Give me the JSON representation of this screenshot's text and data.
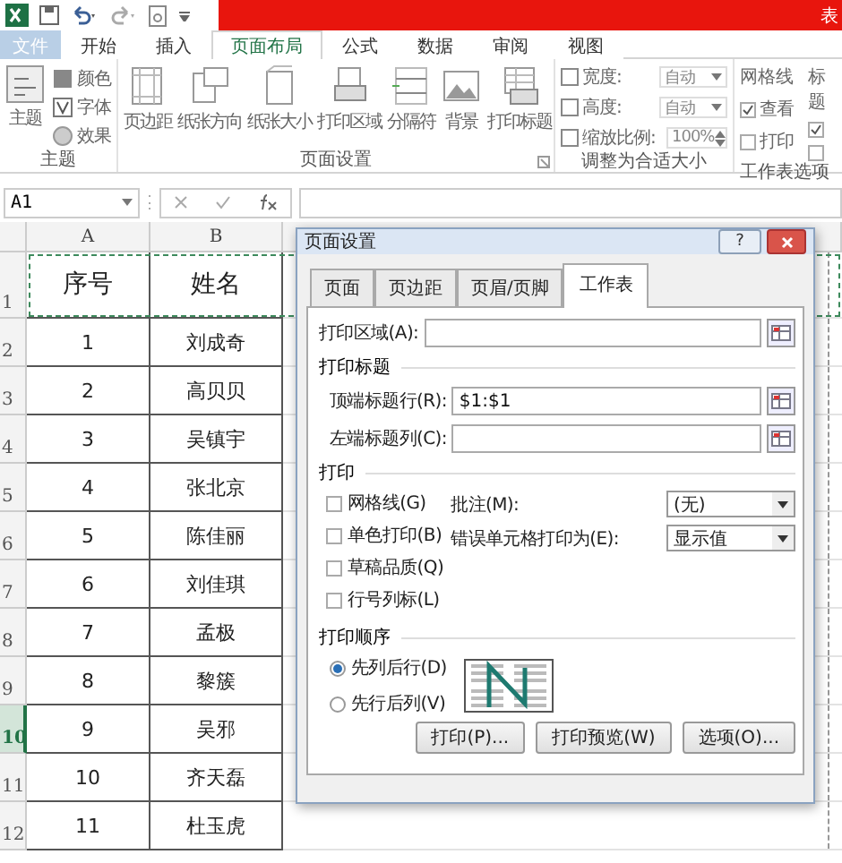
{
  "title_bar": {
    "title": "表"
  },
  "ribbon_tabs": [
    {
      "label": "文件",
      "kind": "file",
      "selected": false
    },
    {
      "label": "开始",
      "kind": "tab",
      "selected": false
    },
    {
      "label": "插入",
      "kind": "tab",
      "selected": false
    },
    {
      "label": "页面布局",
      "kind": "tab",
      "selected": true
    },
    {
      "label": "公式",
      "kind": "tab",
      "selected": false
    },
    {
      "label": "数据",
      "kind": "tab",
      "selected": false
    },
    {
      "label": "审阅",
      "kind": "tab",
      "selected": false
    },
    {
      "label": "视图",
      "kind": "tab",
      "selected": false
    }
  ],
  "ribbon": {
    "theme_group": {
      "label": "主题",
      "big_button": "主题",
      "items": [
        "颜色",
        "字体",
        "效果"
      ]
    },
    "page_setup_group": {
      "label": "页面设置",
      "buttons": [
        "页边距",
        "纸张方向",
        "纸张大小",
        "打印区域",
        "分隔符",
        "背景",
        "打印标题"
      ]
    },
    "scale_group": {
      "label": "调整为合适大小",
      "rows": [
        {
          "label": "宽度:",
          "value": "自动",
          "kind": "dropdown"
        },
        {
          "label": "高度:",
          "value": "自动",
          "kind": "dropdown"
        },
        {
          "label": "缩放比例:",
          "value": "100%",
          "kind": "spinner"
        }
      ]
    },
    "sheet_options_group": {
      "label": "工作表选项",
      "columns": [
        {
          "heading": "网格线",
          "options": [
            {
              "label": "查看",
              "checked": true
            },
            {
              "label": "打印",
              "checked": false
            }
          ]
        },
        {
          "heading": "标题",
          "options": [
            {
              "checked": true
            },
            {
              "checked": false
            }
          ]
        }
      ]
    }
  },
  "formula_bar": {
    "name_box": "A1"
  },
  "sheet": {
    "columns": [
      "A",
      "B"
    ],
    "rows": [
      {
        "number": "1",
        "cells": [
          "序号",
          "姓名"
        ],
        "selected": false,
        "marquee": true
      },
      {
        "number": "2",
        "cells": [
          "1",
          "刘成奇"
        ],
        "selected": false,
        "marquee": false
      },
      {
        "number": "3",
        "cells": [
          "2",
          "高贝贝"
        ],
        "selected": false,
        "marquee": false
      },
      {
        "number": "4",
        "cells": [
          "3",
          "吴镇宇"
        ],
        "selected": false,
        "marquee": false
      },
      {
        "number": "5",
        "cells": [
          "4",
          "张北京"
        ],
        "selected": false,
        "marquee": false
      },
      {
        "number": "6",
        "cells": [
          "5",
          "陈佳丽"
        ],
        "selected": false,
        "marquee": false
      },
      {
        "number": "7",
        "cells": [
          "6",
          "刘佳琪"
        ],
        "selected": false,
        "marquee": false
      },
      {
        "number": "8",
        "cells": [
          "7",
          "孟极"
        ],
        "selected": false,
        "marquee": false
      },
      {
        "number": "9",
        "cells": [
          "8",
          "黎簇"
        ],
        "selected": false,
        "marquee": false
      },
      {
        "number": "10",
        "cells": [
          "9",
          "吴邪"
        ],
        "selected": true,
        "marquee": false
      },
      {
        "number": "11",
        "cells": [
          "10",
          "齐天磊"
        ],
        "selected": false,
        "marquee": false
      },
      {
        "number": "12",
        "cells": [
          "11",
          "杜玉虎"
        ],
        "selected": false,
        "marquee": false
      }
    ]
  },
  "dialog": {
    "title": "页面设置",
    "help": "?",
    "tabs": [
      {
        "label": "页面",
        "selected": false
      },
      {
        "label": "页边距",
        "selected": false
      },
      {
        "label": "页眉/页脚",
        "selected": false
      },
      {
        "label": "工作表",
        "selected": true
      }
    ],
    "print_area": {
      "label": "打印区域(A):"
    },
    "print_titles": {
      "heading": "打印标题",
      "fields": [
        {
          "label": "顶端标题行(R):",
          "value": "$1:$1"
        },
        {
          "label": "左端标题列(C):"
        }
      ]
    },
    "print": {
      "heading": "打印",
      "checkboxes": [
        {
          "label": "网格线(G)",
          "checked": false
        },
        {
          "label": "单色打印(B)",
          "checked": false
        },
        {
          "label": "草稿品质(Q)",
          "checked": false
        },
        {
          "label": "行号列标(L)",
          "checked": false
        }
      ],
      "selects": [
        {
          "label": "批注(M):",
          "value": "(无)"
        },
        {
          "label": "错误单元格打印为(E):",
          "value": "显示值"
        }
      ]
    },
    "page_order": {
      "heading": "打印顺序",
      "options": [
        {
          "label": "先列后行(D)",
          "selected": true
        },
        {
          "label": "先行后列(V)",
          "selected": false
        }
      ]
    },
    "buttons": [
      "打印(P)...",
      "打印预览(W)",
      "选项(O)..."
    ]
  }
}
